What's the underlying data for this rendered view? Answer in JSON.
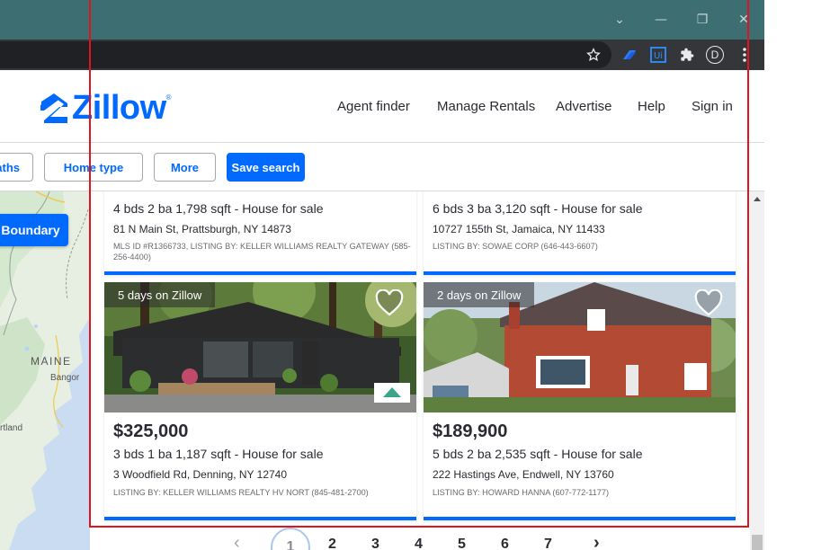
{
  "browser": {
    "window_controls": [
      "⌄",
      "—",
      "❐",
      "✕"
    ],
    "profile_initial": "D"
  },
  "header": {
    "logo_text": "Zillow",
    "logo_mark": "®",
    "nav": [
      "Agent finder",
      "Manage Rentals",
      "Advertise",
      "Help",
      "Sign in"
    ]
  },
  "filters": {
    "baths_label": "aths",
    "home_type_label": "Home type",
    "more_label": "More",
    "save_search_label": "Save search"
  },
  "map": {
    "boundary_label": "Boundary",
    "state_label": "MAINE",
    "city_label": "Bangor",
    "partial_label": "rtland"
  },
  "listings": [
    {
      "facts": "4 bds  2 ba  1,798 sqft  - House for sale",
      "address": "81 N Main St, Prattsburgh, NY 14873",
      "broker": "MLS ID #R1366733, LISTING BY: KELLER WILLIAMS REALTY GATEWAY (585-256-4400)"
    },
    {
      "facts": "6 bds  3 ba  3,120 sqft  - House for sale",
      "address": "10727 155th St, Jamaica, NY 11433",
      "broker": "LISTING BY: SOWAE CORP (646-443-6607)"
    },
    {
      "badge": "5 days on Zillow",
      "price": "$325,000",
      "facts": "3 bds  1 ba  1,187 sqft  - House for sale",
      "address": "3 Woodfield Rd, Denning, NY 12740",
      "broker": "LISTING BY: KELLER WILLIAMS REALTY HV NORT (845-481-2700)"
    },
    {
      "badge": "2 days on Zillow",
      "price": "$189,900",
      "facts": "5 bds  2 ba  2,535 sqft  - House for sale",
      "address": "222 Hastings Ave, Endwell, NY 13760",
      "broker": "LISTING BY: HOWARD HANNA (607-772-1177)"
    }
  ],
  "pagination": {
    "prev": "‹",
    "pages": [
      "1",
      "2",
      "3",
      "4",
      "5",
      "6",
      "7"
    ],
    "current": "1",
    "next": "›"
  },
  "colors": {
    "brand": "#006aff",
    "titlebar": "#3d6f72",
    "highlight_frame": "#e0141e"
  }
}
